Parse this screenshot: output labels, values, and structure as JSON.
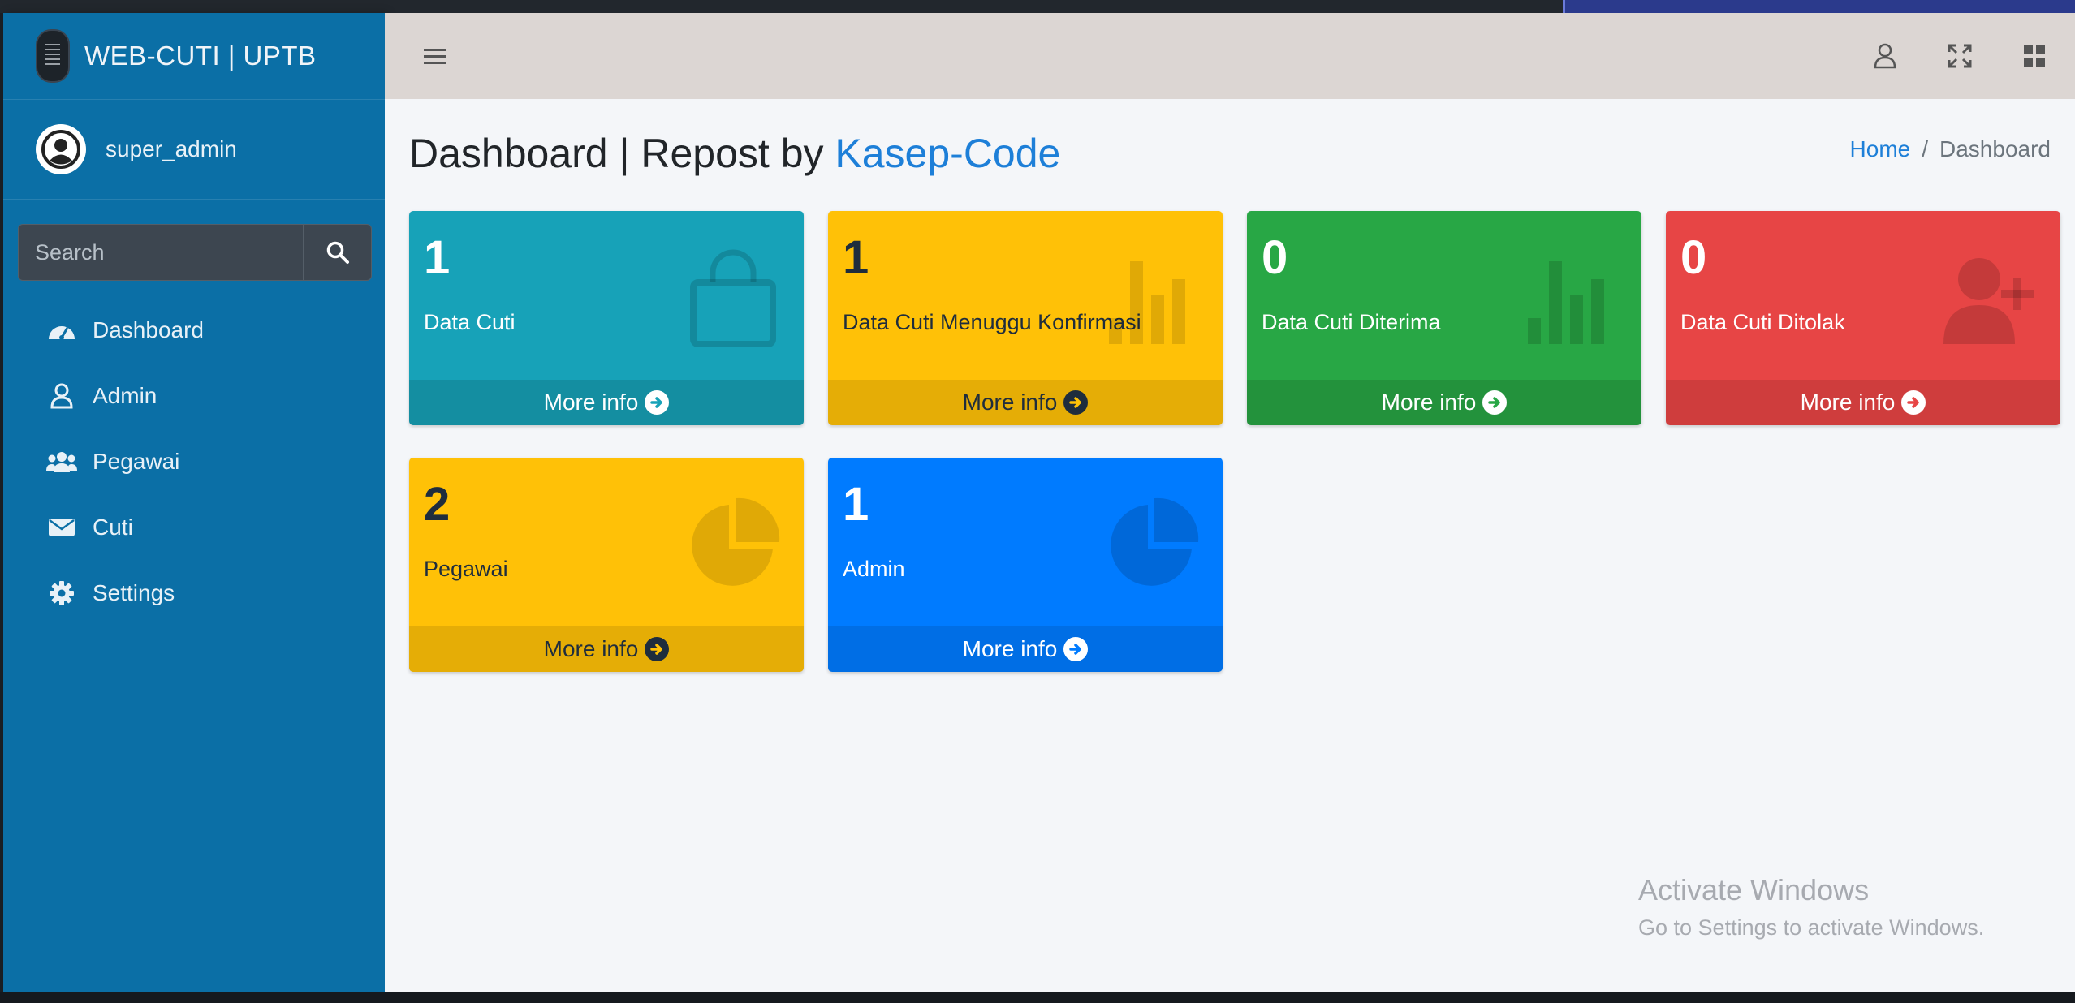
{
  "sidebar": {
    "brand": "WEB-CUTI | UPTB",
    "user": "super_admin",
    "search_placeholder": "Search",
    "items": [
      {
        "label": "Dashboard"
      },
      {
        "label": "Admin"
      },
      {
        "label": "Pegawai"
      },
      {
        "label": "Cuti"
      },
      {
        "label": "Settings"
      }
    ]
  },
  "page": {
    "title_prefix": "Dashboard | Repost by ",
    "title_link": "Kasep-Code",
    "breadcrumb_home": "Home",
    "breadcrumb_sep": "/",
    "breadcrumb_current": "Dashboard"
  },
  "boxes": [
    {
      "value": "1",
      "label": "Data Cuti",
      "more": "More info",
      "color": "#17a2b8",
      "icon": "shopping-bag-icon"
    },
    {
      "value": "1",
      "label": "Data Cuti Menuggu Konfirmasi",
      "more": "More info",
      "color": "#ffc107",
      "icon": "bar-chart-icon"
    },
    {
      "value": "0",
      "label": "Data Cuti Diterima",
      "more": "More info",
      "color": "#28a745",
      "icon": "bar-chart-icon"
    },
    {
      "value": "0",
      "label": "Data Cuti Ditolak",
      "more": "More info",
      "color": "#dc3545",
      "icon": "user-plus-icon"
    },
    {
      "value": "2",
      "label": "Pegawai",
      "more": "More info",
      "color": "#ffc107",
      "icon": "pie-chart-icon"
    },
    {
      "value": "1",
      "label": "Admin",
      "more": "More info",
      "color": "#007bff",
      "icon": "pie-chart-icon"
    }
  ],
  "watermark": {
    "line1": "Activate Windows",
    "line2": "Go to Settings to activate Windows."
  }
}
